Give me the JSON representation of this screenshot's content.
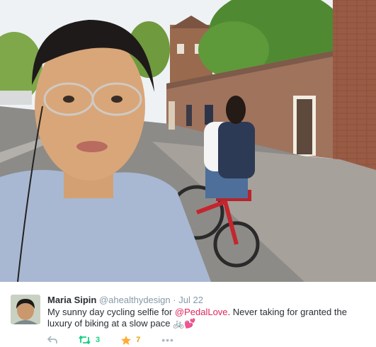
{
  "photo": {
    "alt_subject": "cycling-selfie"
  },
  "tweet": {
    "display_name": "Maria Sipin",
    "handle": "@ahealthydesign",
    "separator": "·",
    "date": "Jul 22",
    "text_prefix": "My sunny day cycling selfie for ",
    "mention": "@PedalLove",
    "text_suffix": ". Never taking for granted the luxury of biking at a slow pace ",
    "emoji": "🚲💕"
  },
  "actions": {
    "reply_icon": "reply-icon",
    "retweet_icon": "retweet-icon",
    "retweet_count": "3",
    "favorite_icon": "star-icon",
    "favorite_count": "7",
    "more_icon": "more-icon",
    "more_label": "•••"
  },
  "colors": {
    "mention": "#e0245e",
    "retweet": "#19cf86",
    "favorite": "#e6a200",
    "muted": "#8899a6",
    "text": "#292f33"
  }
}
